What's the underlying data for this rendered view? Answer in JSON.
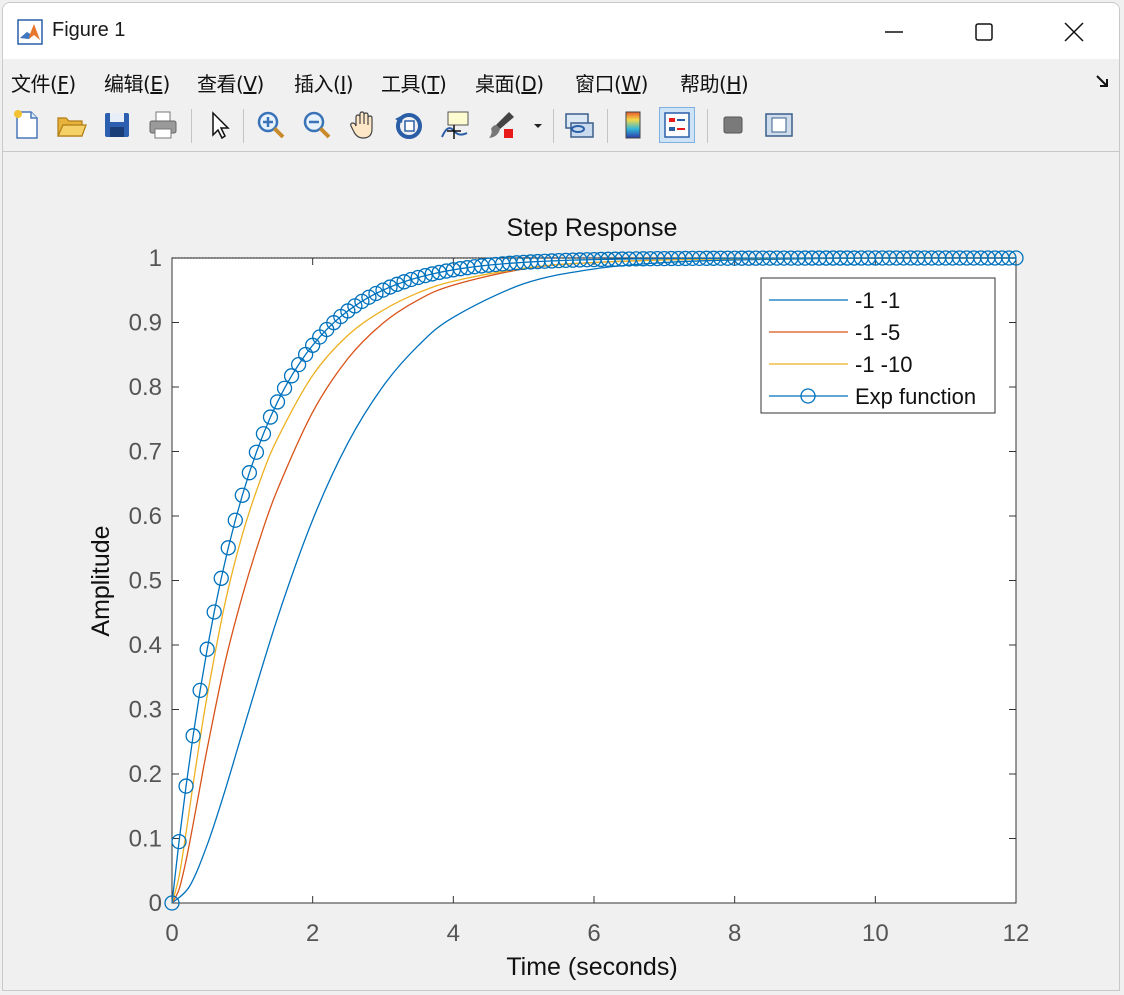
{
  "window": {
    "title": "Figure 1"
  },
  "menu": [
    {
      "label": "文件(",
      "key": "F",
      "suffix": ")"
    },
    {
      "label": "编辑(",
      "key": "E",
      "suffix": ")"
    },
    {
      "label": "查看(",
      "key": "V",
      "suffix": ")"
    },
    {
      "label": "插入(",
      "key": "I",
      "suffix": ")"
    },
    {
      "label": "工具(",
      "key": "T",
      "suffix": ")"
    },
    {
      "label": "桌面(",
      "key": "D",
      "suffix": ")"
    },
    {
      "label": "窗口(",
      "key": "W",
      "suffix": ")"
    },
    {
      "label": "帮助(",
      "key": "H",
      "suffix": ")"
    }
  ],
  "toolbar": {
    "icons": [
      "new-figure-icon",
      "open-file-icon",
      "save-icon",
      "print-icon",
      "pointer-icon",
      "zoom-in-icon",
      "zoom-out-icon",
      "pan-hand-icon",
      "rotate-3d-icon",
      "data-cursor-icon",
      "brush-icon",
      "link-plot-icon",
      "colorbar-icon",
      "legend-icon",
      "hide-plot-tools-icon",
      "show-plot-tools-icon"
    ],
    "active": "legend-icon"
  },
  "chart_data": {
    "type": "line",
    "title": "Step Response",
    "xlabel": "Time (seconds)",
    "ylabel": "Amplitude",
    "xlim": [
      0,
      12
    ],
    "ylim": [
      0,
      1
    ],
    "xticks": [
      0,
      2,
      4,
      6,
      8,
      10,
      12
    ],
    "yticks": [
      0,
      0.1,
      0.2,
      0.3,
      0.4,
      0.5,
      0.6,
      0.7,
      0.8,
      0.9,
      1
    ],
    "xtick_labels": [
      "0",
      "2",
      "4",
      "6",
      "8",
      "10",
      "12"
    ],
    "ytick_labels": [
      "0",
      "0.1",
      "0.2",
      "0.3",
      "0.4",
      "0.5",
      "0.6",
      "0.7",
      "0.8",
      "0.9",
      "1"
    ],
    "grid": false,
    "legend_position": "top-right",
    "series": [
      {
        "name": "-1 -1",
        "color": "#0072bd",
        "marker": "none",
        "x": [
          0,
          0.25,
          0.5,
          0.75,
          1,
          1.5,
          2,
          2.5,
          3,
          3.5,
          4,
          5,
          6,
          7,
          8,
          10,
          12
        ],
        "y": [
          0,
          0.026,
          0.09,
          0.173,
          0.264,
          0.442,
          0.594,
          0.713,
          0.801,
          0.864,
          0.908,
          0.96,
          0.983,
          0.993,
          0.997,
          1.0,
          1.0
        ]
      },
      {
        "name": "-1 -5",
        "color": "#d95319",
        "marker": "none",
        "x": [
          0,
          0.1,
          0.2,
          0.3,
          0.4,
          0.5,
          0.75,
          1,
          1.25,
          1.5,
          2,
          2.5,
          3,
          3.5,
          4,
          5,
          6,
          8,
          12
        ],
        "y": [
          0,
          0.021,
          0.066,
          0.122,
          0.181,
          0.239,
          0.371,
          0.476,
          0.565,
          0.641,
          0.761,
          0.844,
          0.899,
          0.935,
          0.958,
          0.983,
          0.993,
          0.999,
          1.0
        ]
      },
      {
        "name": "-1 -10",
        "color": "#edb120",
        "marker": "none",
        "x": [
          0,
          0.1,
          0.2,
          0.3,
          0.4,
          0.5,
          0.75,
          1,
          1.25,
          1.5,
          2,
          2.5,
          3,
          3.5,
          4,
          5,
          6,
          8,
          12
        ],
        "y": [
          0,
          0.041,
          0.109,
          0.184,
          0.255,
          0.321,
          0.463,
          0.571,
          0.654,
          0.72,
          0.818,
          0.88,
          0.919,
          0.946,
          0.964,
          0.984,
          0.993,
          0.999,
          1.0
        ]
      },
      {
        "name": "Exp function",
        "color": "#0072bd",
        "marker": "circle",
        "x_start": 0,
        "x_step": 0.1,
        "x_end": 12,
        "y_formula": "1 - exp(-t)"
      }
    ]
  }
}
